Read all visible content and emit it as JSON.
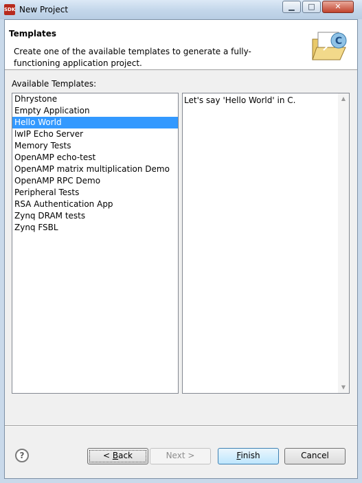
{
  "window": {
    "title": "New Project",
    "app_icon_text": "SDK",
    "controls": {
      "minimize": "▁",
      "maximize": "□",
      "close": "✕"
    }
  },
  "header": {
    "title": "Templates",
    "description": "Create one of the available templates to generate a fully-functioning application project.",
    "icon": "folder-c-icon"
  },
  "templates": {
    "label": "Available Templates:",
    "items": [
      "Dhrystone",
      "Empty Application",
      "Hello World",
      "lwIP Echo Server",
      "Memory Tests",
      "OpenAMP echo-test",
      "OpenAMP matrix multiplication Demo",
      "OpenAMP RPC Demo",
      "Peripheral Tests",
      "RSA Authentication App",
      "Zynq DRAM tests",
      "Zynq FSBL"
    ],
    "selected": "Hello World"
  },
  "description_panel": {
    "text": "Let's say 'Hello World' in C."
  },
  "buttons": {
    "help": "?",
    "back": {
      "prefix": "< ",
      "mnemonic": "B",
      "rest": "ack"
    },
    "next": "Next >",
    "finish": {
      "mnemonic": "F",
      "rest": "inish"
    },
    "cancel": "Cancel"
  }
}
